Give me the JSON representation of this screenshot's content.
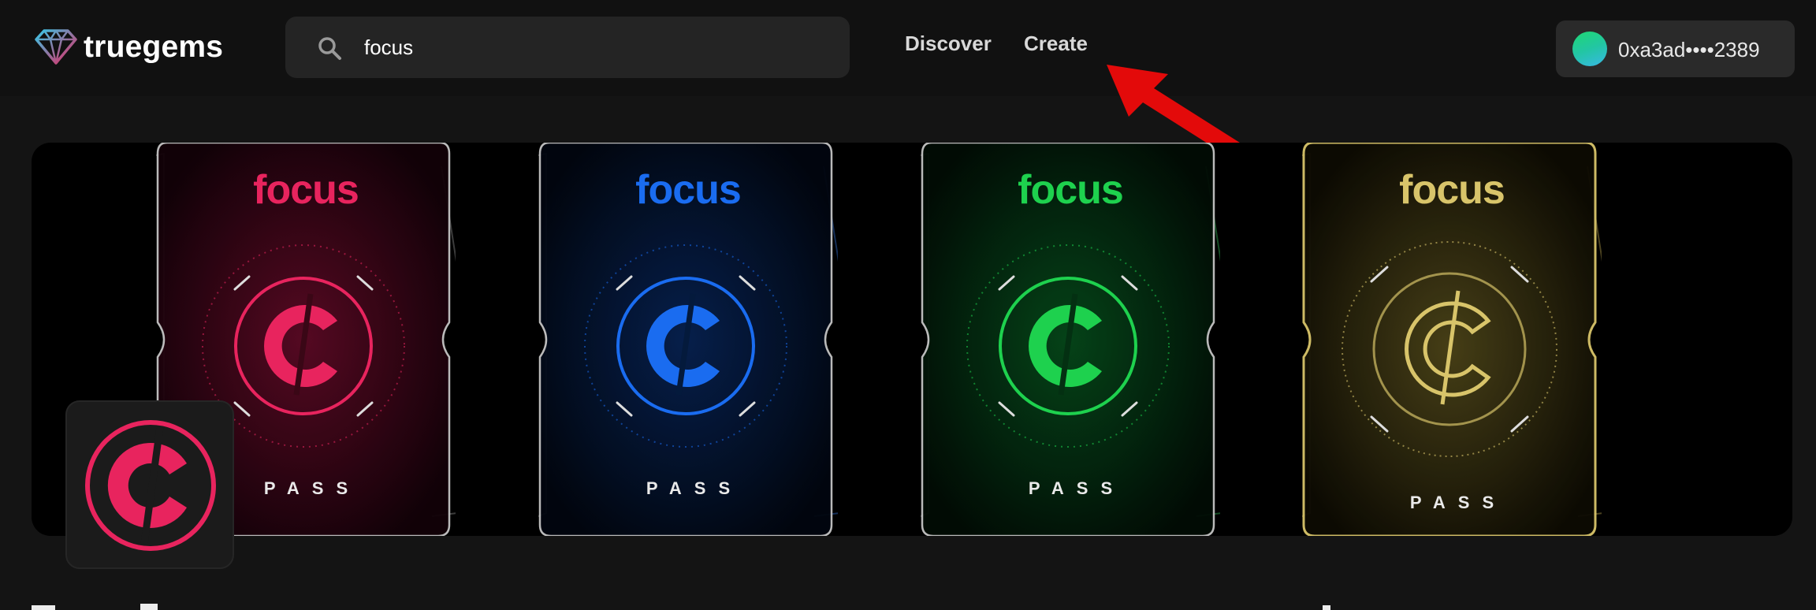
{
  "brand": {
    "name": "truegems",
    "logo_icon": "diamond-logo-icon"
  },
  "search": {
    "icon": "search-icon",
    "value": "focus"
  },
  "nav": {
    "discover": "Discover",
    "create": "Create"
  },
  "wallet": {
    "address": "0xa3ad••••2389",
    "avatar": "gradient-avatar"
  },
  "annotation": {
    "type": "arrow",
    "color": "#e30a0a",
    "points_to": "Create"
  },
  "banner": {
    "cards": [
      {
        "brand": "focus",
        "label": "PASS",
        "color": "#e8245e",
        "glow": "#5a0a24"
      },
      {
        "brand": "focus",
        "label": "PASS",
        "color": "#1a6cf0",
        "glow": "#07214f"
      },
      {
        "brand": "focus",
        "label": "PASS",
        "color": "#1ed14e",
        "glow": "#06471a"
      },
      {
        "brand": "focus",
        "label": "PASS",
        "color": "#d8c46a",
        "glow": "#4a4218"
      }
    ]
  },
  "collection": {
    "icon": "focus-c-logo-icon",
    "color": "#e8245e"
  },
  "colors": {
    "background": "#141414",
    "header": "#111111",
    "accent_red": "#e30a0a"
  }
}
